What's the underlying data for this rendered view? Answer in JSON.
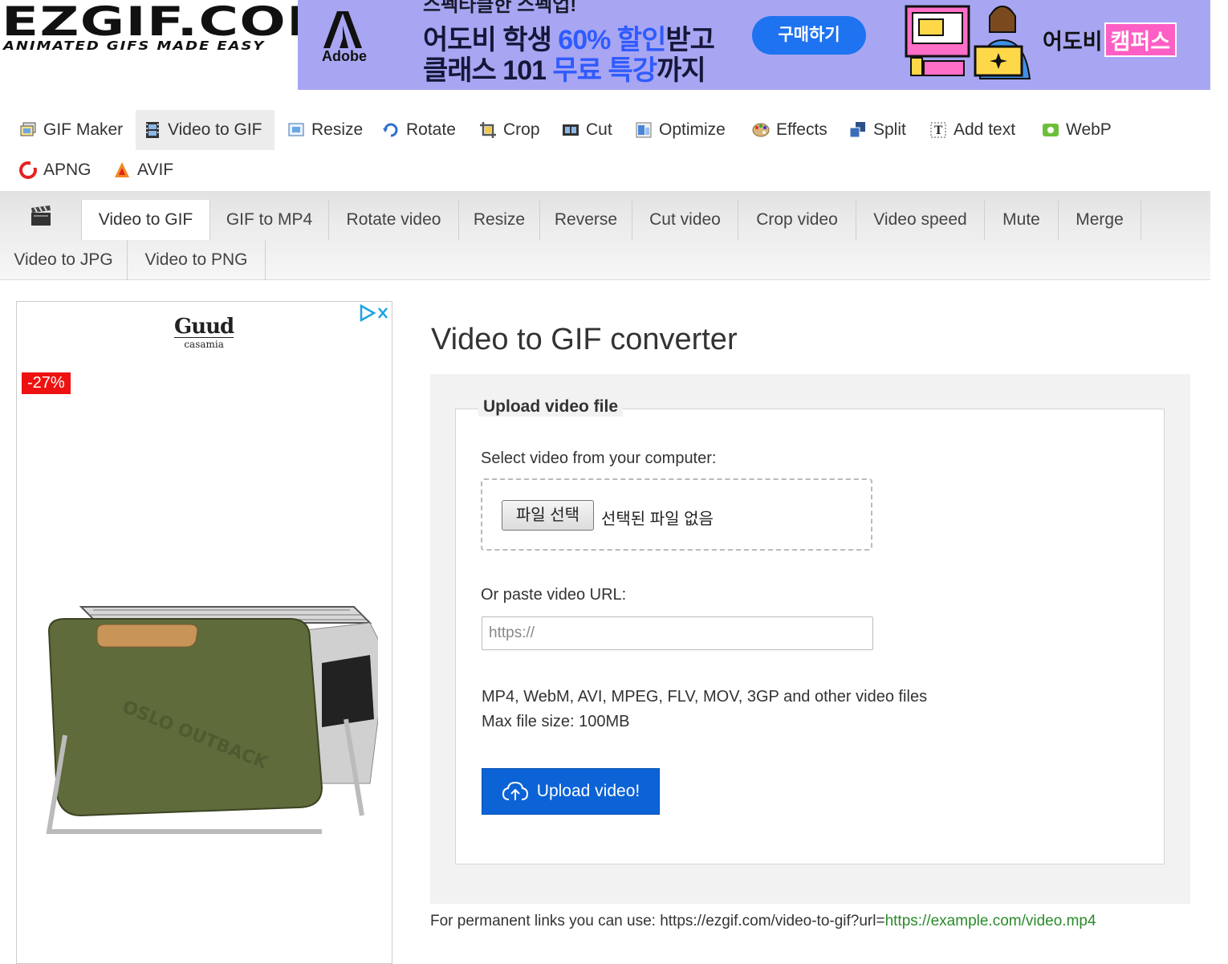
{
  "header": {
    "logo_main": "EZGIF.COM",
    "logo_sub": "ANIMATED GIFS MADE EASY"
  },
  "banner": {
    "adobe_word": "Adobe",
    "top_text": "스펙타클한 스펙업!",
    "line1_a": "어도비 학생 ",
    "line1_hl": "60% 할인",
    "line1_b": "받고",
    "line2_a": "클래스 101 ",
    "line2_hl": "무료 특강",
    "line2_b": "까지",
    "cta": "구매하기",
    "brand": "어도비",
    "brand_tag": "캠퍼스",
    "bg_color": "#a8a6f2",
    "cta_color": "#1e73f0"
  },
  "mainnav": {
    "items": [
      {
        "label": "GIF Maker",
        "icon": "gif-maker-icon"
      },
      {
        "label": "Video to GIF",
        "icon": "film-icon"
      },
      {
        "label": "Resize",
        "icon": "resize-icon"
      },
      {
        "label": "Rotate",
        "icon": "rotate-icon"
      },
      {
        "label": "Crop",
        "icon": "crop-icon"
      },
      {
        "label": "Cut",
        "icon": "cut-icon"
      },
      {
        "label": "Optimize",
        "icon": "optimize-icon"
      },
      {
        "label": "Effects",
        "icon": "palette-icon"
      },
      {
        "label": "Split",
        "icon": "split-icon"
      },
      {
        "label": "Add text",
        "icon": "add-text-icon"
      },
      {
        "label": "WebP",
        "icon": "webp-icon"
      },
      {
        "label": "APNG",
        "icon": "apng-icon"
      },
      {
        "label": "AVIF",
        "icon": "avif-icon"
      }
    ]
  },
  "subnav": {
    "items": [
      {
        "label": "Video to GIF"
      },
      {
        "label": "GIF to MP4"
      },
      {
        "label": "Rotate video"
      },
      {
        "label": "Resize"
      },
      {
        "label": "Reverse"
      },
      {
        "label": "Cut video"
      },
      {
        "label": "Crop video"
      },
      {
        "label": "Video speed"
      },
      {
        "label": "Mute"
      },
      {
        "label": "Merge"
      },
      {
        "label": "Video to JPG"
      },
      {
        "label": "Video to PNG"
      }
    ]
  },
  "ad": {
    "brand_name": "Guud",
    "brand_sub": "casamia",
    "badge": "-27%"
  },
  "converter": {
    "title": "Video to GIF converter",
    "legend": "Upload video file",
    "select_label": "Select video from your computer:",
    "file_button": "파일 선택",
    "file_none": "선택된 파일 없음",
    "url_label": "Or paste video URL:",
    "url_placeholder": "https://",
    "formats": "MP4, WebM, AVI, MPEG, FLV, MOV, 3GP and other video files",
    "max_size": "Max file size: 100MB",
    "upload_button": "Upload video!",
    "permalink_prefix": "For permanent links you can use: https://ezgif.com/video-to-gif?url=",
    "permalink_example": "https://example.com/video.mp4"
  }
}
